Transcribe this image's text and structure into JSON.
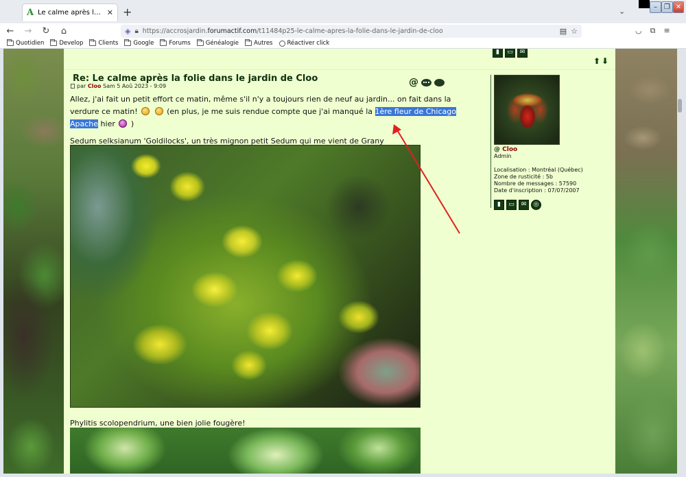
{
  "browser": {
    "tab_title": "Le calme après la folie dans le j",
    "tab_favicon": "A",
    "new_tab": "+",
    "tab_list": "⌄",
    "url_prefix": "https://accrosjardin.",
    "url_domain": "forumactif.com",
    "url_path": "/t11484p25-le-calme-apres-la-folie-dans-le-jardin-de-cloo",
    "window_buttons": [
      "–",
      "❐",
      "✕"
    ]
  },
  "bookmarks": [
    {
      "label": "Quotidien",
      "icon": "folder-icon"
    },
    {
      "label": "Develop",
      "icon": "folder-icon"
    },
    {
      "label": "Clients",
      "icon": "folder-icon"
    },
    {
      "label": "Google",
      "icon": "folder-icon"
    },
    {
      "label": "Forums",
      "icon": "folder-icon"
    },
    {
      "label": "Généalogie",
      "icon": "folder-icon"
    },
    {
      "label": "Autres",
      "icon": "folder-icon"
    },
    {
      "label": "Réactiver click",
      "icon": "globe-icon"
    }
  ],
  "post": {
    "title": "Re: Le calme après la folie dans le jardin de Cloo",
    "meta_by": "par",
    "author": "Cloo",
    "date": "Sam 5 Aoû 2023 - 9:09",
    "quote_icon": "@",
    "body_part1": "Allez, j'ai fait un petit effort ce matin, même s'il n'y a toujours rien de neuf au jardin... on fait dans la verdure ce matin!",
    "body_part2": "(en plus, je me suis rendue compte que j'ai manqué la",
    "selected_text": "1ère fleur de Chicago Apache",
    "body_part3": "hier",
    "body_part4": ")",
    "caption1": "Sedum selksianum 'Goldilocks', un très mignon petit Sedum qui me vient de Grany",
    "caption2": "Phylitis scolopendrium, une bien jolie fougère!"
  },
  "profile": {
    "at": "@",
    "name": "Cloo",
    "role": "Admin",
    "location": "Localisation : Montréal (Québec)",
    "zone": "Zone de rusticité : 5b",
    "messages": "Nombre de messages : 57590",
    "joined": "Date d'inscription : 07/07/2007"
  },
  "colors": {
    "post_bg": "#efffcf",
    "title": "#103010",
    "author": "#8b0000",
    "selection": "#3a77d6",
    "arrow": "#e02020"
  }
}
